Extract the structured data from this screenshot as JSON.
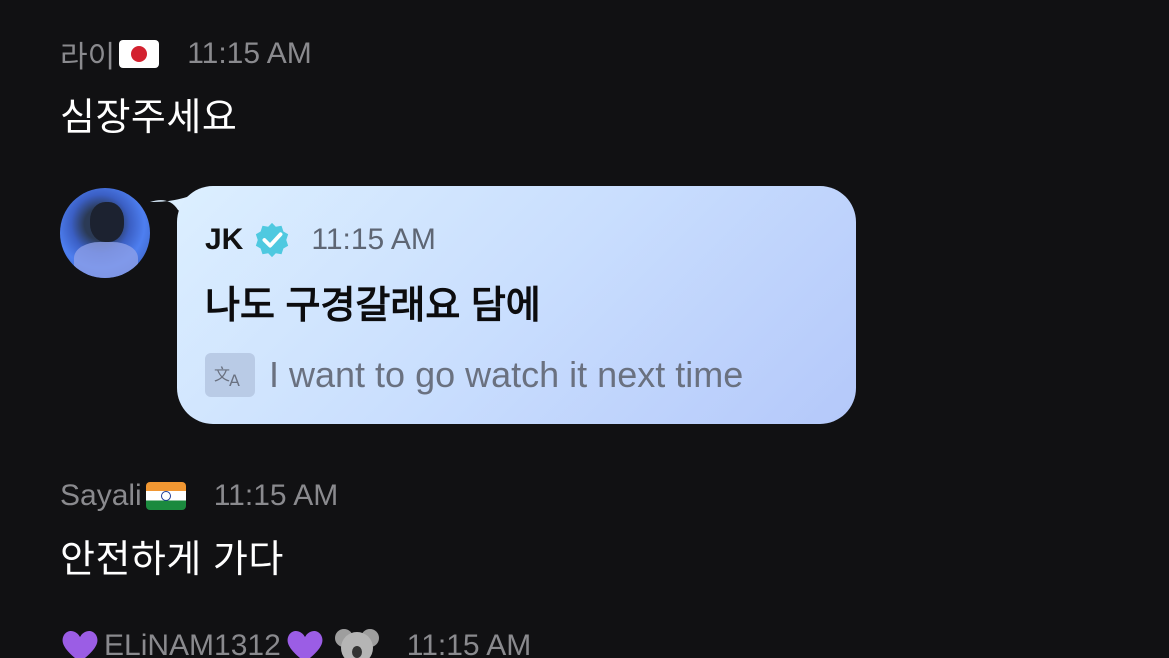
{
  "messages": [
    {
      "user": "라이",
      "flag": "jp-flag-icon",
      "time": "11:15 AM",
      "text": "심장주세요"
    },
    {
      "user": "JK",
      "verified": "verified-badge-icon",
      "time": "11:15 AM",
      "text": "나도 구경갈래요 담에",
      "translation": "I want to go watch it next time",
      "translate_icon": "translate-icon"
    },
    {
      "user": "Sayali",
      "flag": "in-flag-icon",
      "time": "11:15 AM",
      "text": "안전하게 가다"
    },
    {
      "user": "ELiNAM1312",
      "prefix_icon": "purple-heart-icon",
      "suffix_icons": [
        "purple-heart-icon",
        "koala-icon"
      ],
      "time": "11:15 AM"
    }
  ],
  "colors": {
    "background": "#111113",
    "bubble_start": "#dcefff",
    "bubble_end": "#b4c8fa",
    "verified": "#4fc9e0",
    "meta": "#8a8a8e"
  }
}
